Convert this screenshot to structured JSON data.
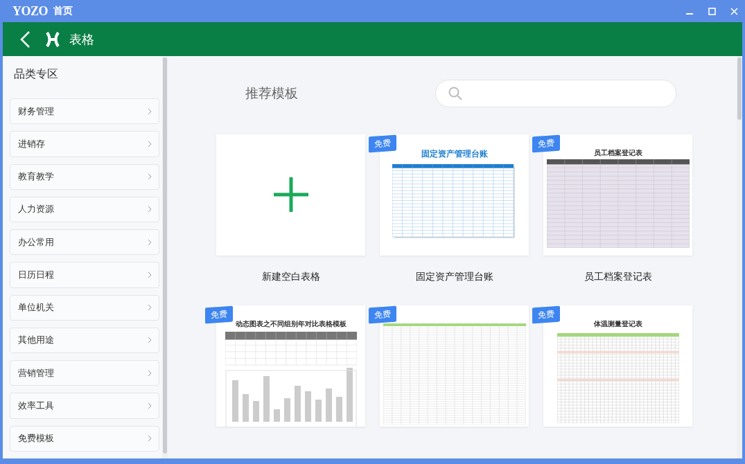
{
  "window": {
    "logo": "YOZO",
    "title": "首页"
  },
  "header": {
    "title": "表格"
  },
  "sidebar": {
    "title": "品类专区",
    "items": [
      {
        "label": "财务管理"
      },
      {
        "label": "进销存"
      },
      {
        "label": "教育教学"
      },
      {
        "label": "人力资源"
      },
      {
        "label": "办公常用"
      },
      {
        "label": "日历日程"
      },
      {
        "label": "单位机关"
      },
      {
        "label": "其他用途"
      },
      {
        "label": "营销管理"
      },
      {
        "label": "效率工具"
      },
      {
        "label": "免费模板"
      }
    ]
  },
  "main": {
    "section_title": "推荐模板",
    "cards": [
      {
        "kind": "blank",
        "label": "新建空白表格"
      },
      {
        "kind": "ledger",
        "label": "固定资产管理台账",
        "badge": "免费",
        "preview_title": "固定资产管理台账"
      },
      {
        "kind": "roster",
        "label": "员工档案登记表",
        "badge": "免费",
        "preview_title": "员工档案登记表"
      },
      {
        "kind": "chart",
        "badge": "免费",
        "preview_title": "动态图表之不同组别年对比表格模板"
      },
      {
        "kind": "form",
        "badge": "免费"
      },
      {
        "kind": "temperature",
        "badge": "免费",
        "preview_title": "体温测量登记表"
      }
    ]
  }
}
